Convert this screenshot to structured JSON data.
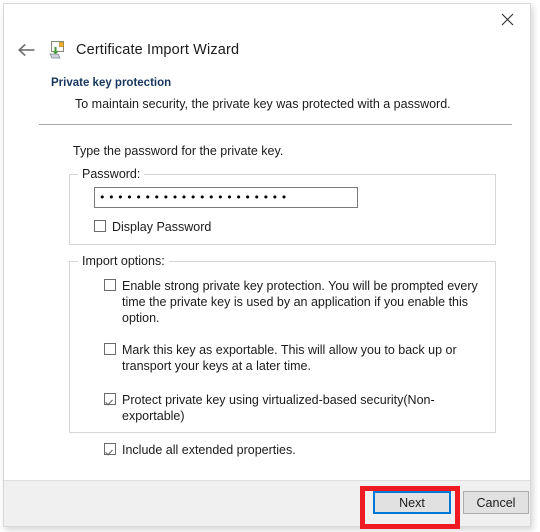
{
  "window": {
    "title": "Certificate Import Wizard",
    "app_icon": "certificate-import-icon",
    "back_icon": "back-arrow-icon",
    "close_icon": "close-icon"
  },
  "heading": {
    "title": "Private key protection",
    "subtitle": "To maintain security, the private key was protected with a password."
  },
  "body": {
    "instruction": "Type the password for the private key."
  },
  "password_group": {
    "legend": "Password:",
    "value": "•••••••••••••••••••••",
    "placeholder": "",
    "display_password": {
      "label": "Display Password",
      "checked": false
    }
  },
  "import_options_group": {
    "legend": "Import options:",
    "options": [
      {
        "label": "Enable strong private key protection. You will be prompted every time the private key is used by an application if you enable this option.",
        "checked": false
      },
      {
        "label": "Mark this key as exportable. This will allow you to back up or transport your keys at a later time.",
        "checked": false
      },
      {
        "label": "Protect private key using virtualized-based security(Non-exportable)",
        "checked": true
      },
      {
        "label": "Include all extended properties.",
        "checked": true
      }
    ]
  },
  "footer": {
    "next_label": "Next",
    "cancel_label": "Cancel"
  },
  "colors": {
    "heading_text": "#17365d",
    "focus_border": "#0078d7",
    "annotation": "#ee1b22",
    "footer_background": "#f0f0f0"
  }
}
